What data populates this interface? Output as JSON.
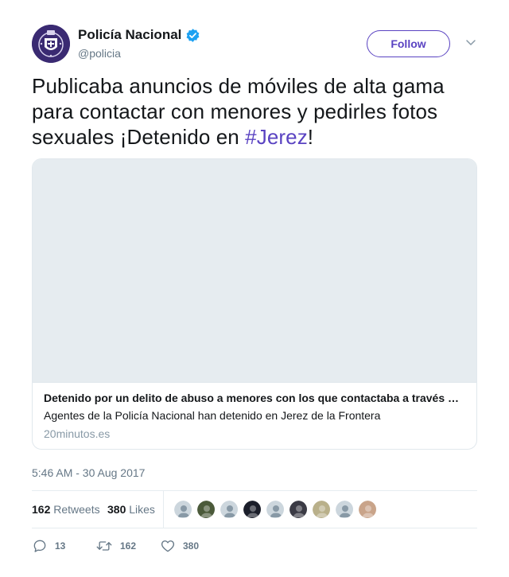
{
  "author": {
    "display_name": "Policía Nacional",
    "handle": "@policia",
    "verified": true,
    "avatar_icon": "police-shield-icon"
  },
  "follow_label": "Follow",
  "tweet": {
    "text_before": "Publicaba anuncios de móviles de alta gama para contactar con menores y pedirles fotos sexuales ¡Detenido en ",
    "hashtag": "#Jerez",
    "text_after": "!"
  },
  "card": {
    "title": "Detenido por un delito de abuso a menores con los que contactaba a través de anuncios de móviles",
    "description": "Agentes de la Policía Nacional han detenido en Jerez de la Frontera",
    "domain": "20minutos.es"
  },
  "timestamp": "5:46 AM - 30 Aug 2017",
  "stats": {
    "retweets_count": "162",
    "retweets_label": "Retweets",
    "likes_count": "380",
    "likes_label": "Likes"
  },
  "likers": [
    {
      "icon": "default-avatar-icon",
      "color": "#ccd6dd"
    },
    {
      "icon": "user-avatar-icon",
      "color": "#4b5a3a"
    },
    {
      "icon": "default-avatar-icon",
      "color": "#ccd6dd"
    },
    {
      "icon": "user-avatar-icon",
      "color": "#1b1e2a"
    },
    {
      "icon": "default-avatar-icon",
      "color": "#ccd6dd"
    },
    {
      "icon": "user-avatar-icon",
      "color": "#3b3b45"
    },
    {
      "icon": "user-avatar-icon",
      "color": "#b9b08a"
    },
    {
      "icon": "default-avatar-icon",
      "color": "#ccd6dd"
    },
    {
      "icon": "user-avatar-icon",
      "color": "#c9a48a"
    }
  ],
  "actions": {
    "reply_count": "13",
    "retweet_count": "162",
    "like_count": "380"
  },
  "colors": {
    "accent": "#5a43c2",
    "verified": "#1da1f2",
    "muted": "#657786"
  }
}
